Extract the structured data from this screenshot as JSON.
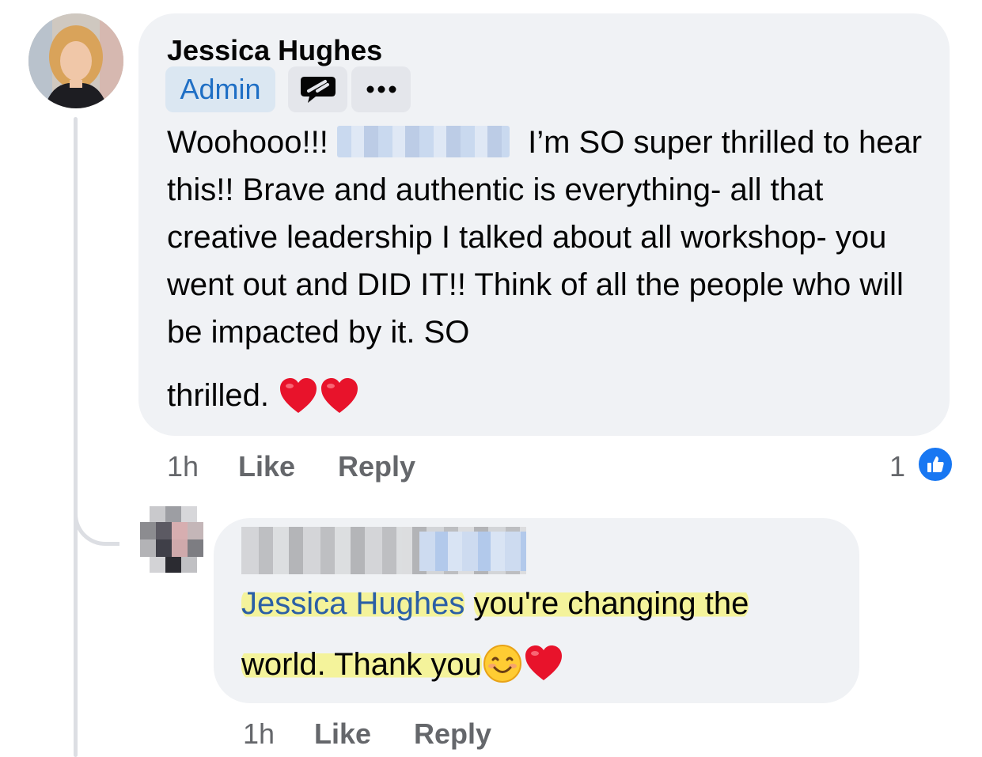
{
  "comment": {
    "author": "Jessica Hughes",
    "badge": "Admin",
    "text_lead": "Woohooo!!!",
    "text_body": "I’m SO super thrilled to hear this!! Brave and authentic is everything- all that creative leadership I talked about all workshop- you went out and DID IT!! Think of all the people who will be impacted by it. SO",
    "text_last": "thrilled.",
    "time": "1h",
    "like_label": "Like",
    "reply_label": "Reply",
    "reaction_count": "1"
  },
  "reply": {
    "mention": "Jessica Hughes",
    "text_line1": "you're changing the",
    "text_line2": "world. Thank you",
    "time": "1h",
    "like_label": "Like",
    "reply_label": "Reply"
  },
  "icons": {
    "message": "message-bubble-icon",
    "more": "more-options-icon",
    "like_reaction": "thumbs-up-icon",
    "heart": "red-heart-emoji",
    "smile": "smiling-face-emoji"
  },
  "colors": {
    "bubble": "#f0f2f5",
    "admin_bg": "#dbe7f2",
    "admin_text": "#1f6fc5",
    "like_blue": "#1877f2",
    "highlight": "#f4f39b",
    "meta_gray": "#65676b"
  }
}
